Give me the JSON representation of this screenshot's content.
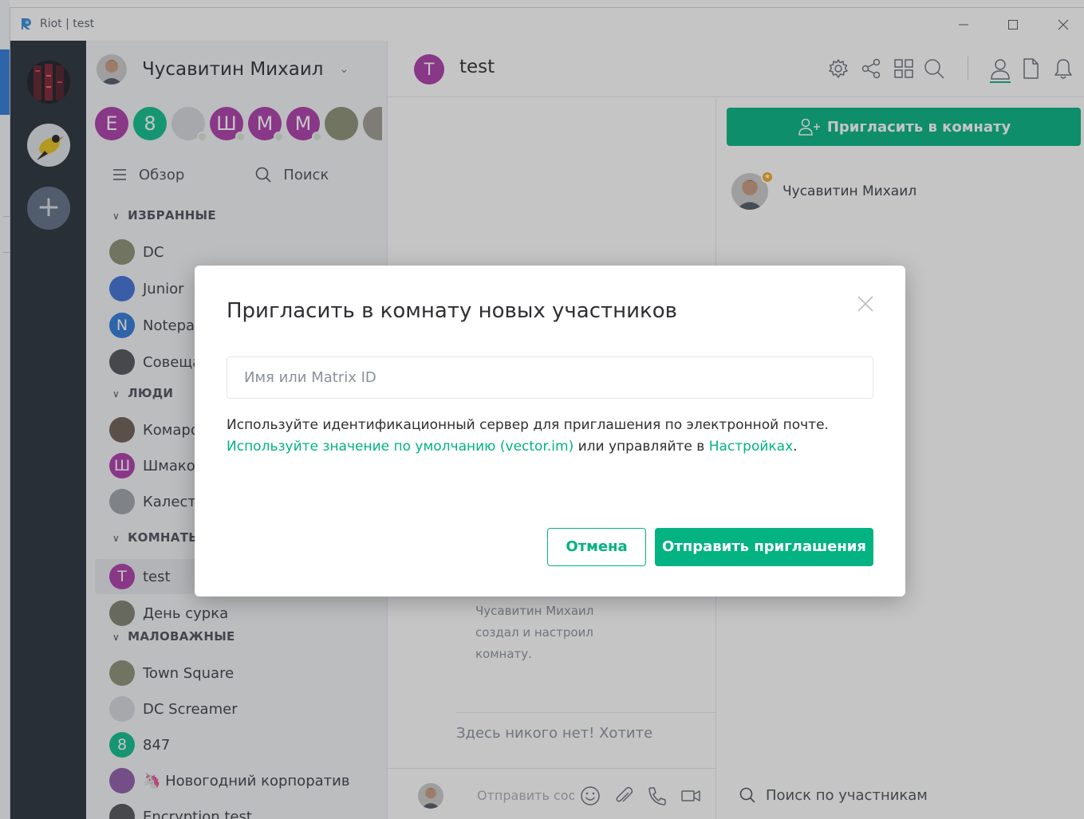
{
  "window": {
    "title": "Riot | test"
  },
  "user": {
    "name": "Чусавитин Михаил"
  },
  "strip": [
    {
      "letter": "E",
      "color": "#ac3ba8"
    },
    {
      "letter": "8",
      "color": "#0dbd8b"
    },
    {
      "letter": "",
      "color": "#d5d7da"
    },
    {
      "letter": "Ш",
      "color": "#ac3ba8"
    },
    {
      "letter": "M",
      "color": "#ac3ba8"
    },
    {
      "letter": "M",
      "color": "#ac3ba8"
    },
    {
      "letter": "",
      "color": "#8b8f73"
    },
    {
      "letter": "",
      "color": "#9e9a93"
    }
  ],
  "tools": {
    "explore": "Обзор",
    "search": "Поиск"
  },
  "sections": {
    "favourites": "ИЗБРАННЫЕ",
    "people": "ЛЮДИ",
    "rooms": "КОМНАТЫ",
    "low_priority": "МАЛОВАЖНЫЕ"
  },
  "favourites": [
    {
      "name": "DC",
      "letter": "",
      "color": "#8b8f73"
    },
    {
      "name": "Junior",
      "letter": "",
      "color": "#3f6fd6"
    },
    {
      "name": "Notepad",
      "letter": "N",
      "color": "#2e79d6"
    },
    {
      "name": "Совещания",
      "letter": "",
      "color": "#505357"
    }
  ],
  "people": [
    {
      "name": "Комарова",
      "letter": "",
      "color": "#6b5d52"
    },
    {
      "name": "Шмаков",
      "letter": "Ш",
      "color": "#ac3ba8"
    },
    {
      "name": "Калестин",
      "letter": "",
      "color": "#9ea3a8"
    }
  ],
  "rooms": [
    {
      "name": "test",
      "letter": "T",
      "color": "#ac3ba8"
    },
    {
      "name": "День сурка",
      "letter": "",
      "color": "#7d7f6f"
    }
  ],
  "low_priority": [
    {
      "name": "Town Square",
      "letter": "",
      "color": "#8b8f73"
    },
    {
      "name": "DC Screamer",
      "letter": "",
      "color": "#d5d7da"
    },
    {
      "name": "847",
      "letter": "8",
      "color": "#0dbd8b"
    },
    {
      "name": "🦄 Новогодний корпоратив",
      "letter": "",
      "color": "#8e5aa8"
    },
    {
      "name": "Encryption test",
      "letter": "",
      "color": "#505357"
    }
  ],
  "room": {
    "letter": "T",
    "name": "test",
    "created_text": "Чусавитин Михаил создал и настроил комнату.",
    "empty_text": "Здесь никого нет! Хотите",
    "composer_placeholder": "Отправить сообщение…"
  },
  "members_panel": {
    "invite_label": "Пригласить в комнату",
    "member_name": "Чусавитин Михаил",
    "search_label": "Поиск по участникам"
  },
  "dialog": {
    "title": "Пригласить в комнату новых участников",
    "input_placeholder": "Имя или Matrix ID",
    "info_line1": "Используйте идентификационный сервер для приглашения по электронной почте.",
    "info_link1": "Используйте значение по умолчанию (vector.im)",
    "info_mid": " или управляйте в ",
    "info_link2": "Настройках",
    "info_end": ".",
    "cancel_label": "Отмена",
    "send_label": "Отправить приглашения"
  },
  "colors": {
    "accent": "#03b381",
    "rail": "#27303a",
    "sidebar": "#f3f4f6"
  }
}
